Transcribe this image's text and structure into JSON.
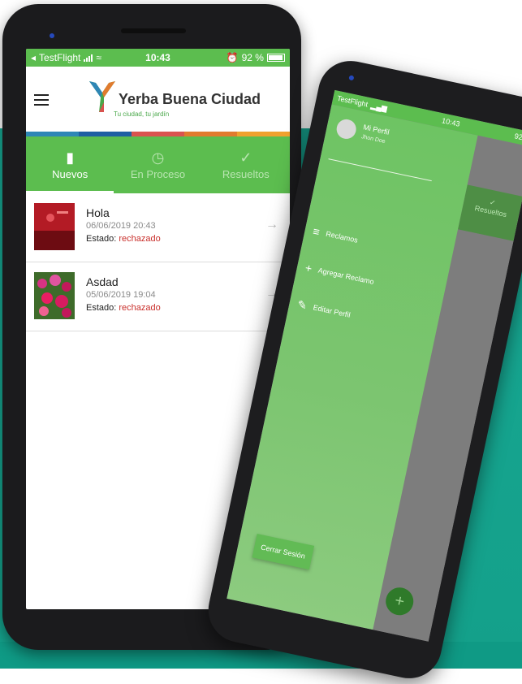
{
  "colors": {
    "teal": "#17a893",
    "green": "#5cbd4f",
    "accent_red": "#c9302c",
    "strip": [
      "#2e86b5",
      "#1f5fa3",
      "#d9534f",
      "#e17b2e",
      "#f0a12e"
    ]
  },
  "phone1": {
    "status": {
      "carrier": "TestFlight",
      "time": "10:43",
      "battery": "92 %"
    },
    "header": {
      "menu_icon": "hamburger-icon",
      "brand": "Yerba Buena Ciudad",
      "tagline": "Tu ciudad, tu jardín"
    },
    "tabs": [
      {
        "label": "Nuevos",
        "icon": "document-icon"
      },
      {
        "label": "En Proceso",
        "icon": "timer-icon"
      },
      {
        "label": "Resueltos",
        "icon": "check-icon"
      }
    ],
    "items": [
      {
        "title": "Hola",
        "date": "06/06/2019 20:43",
        "state_label": "Estado:",
        "state": "rechazado"
      },
      {
        "title": "Asdad",
        "date": "05/06/2019 19:04",
        "state_label": "Estado:",
        "state": "rechazado"
      }
    ]
  },
  "phone2": {
    "status": {
      "carrier": "TestFlight",
      "time": "10:43",
      "battery": "92 %"
    },
    "profile": {
      "title": "Mi Perfil",
      "user": "Jhon Doe"
    },
    "menu": [
      {
        "label": "Reclamos",
        "icon": "list-icon"
      },
      {
        "label": "Agregar Reclamo",
        "icon": "plus-icon"
      },
      {
        "label": "Editar Perfil",
        "icon": "pencil-icon"
      }
    ],
    "logout": "Cerrar Sesión",
    "background_tab": "Resueltos",
    "fab": "+"
  }
}
